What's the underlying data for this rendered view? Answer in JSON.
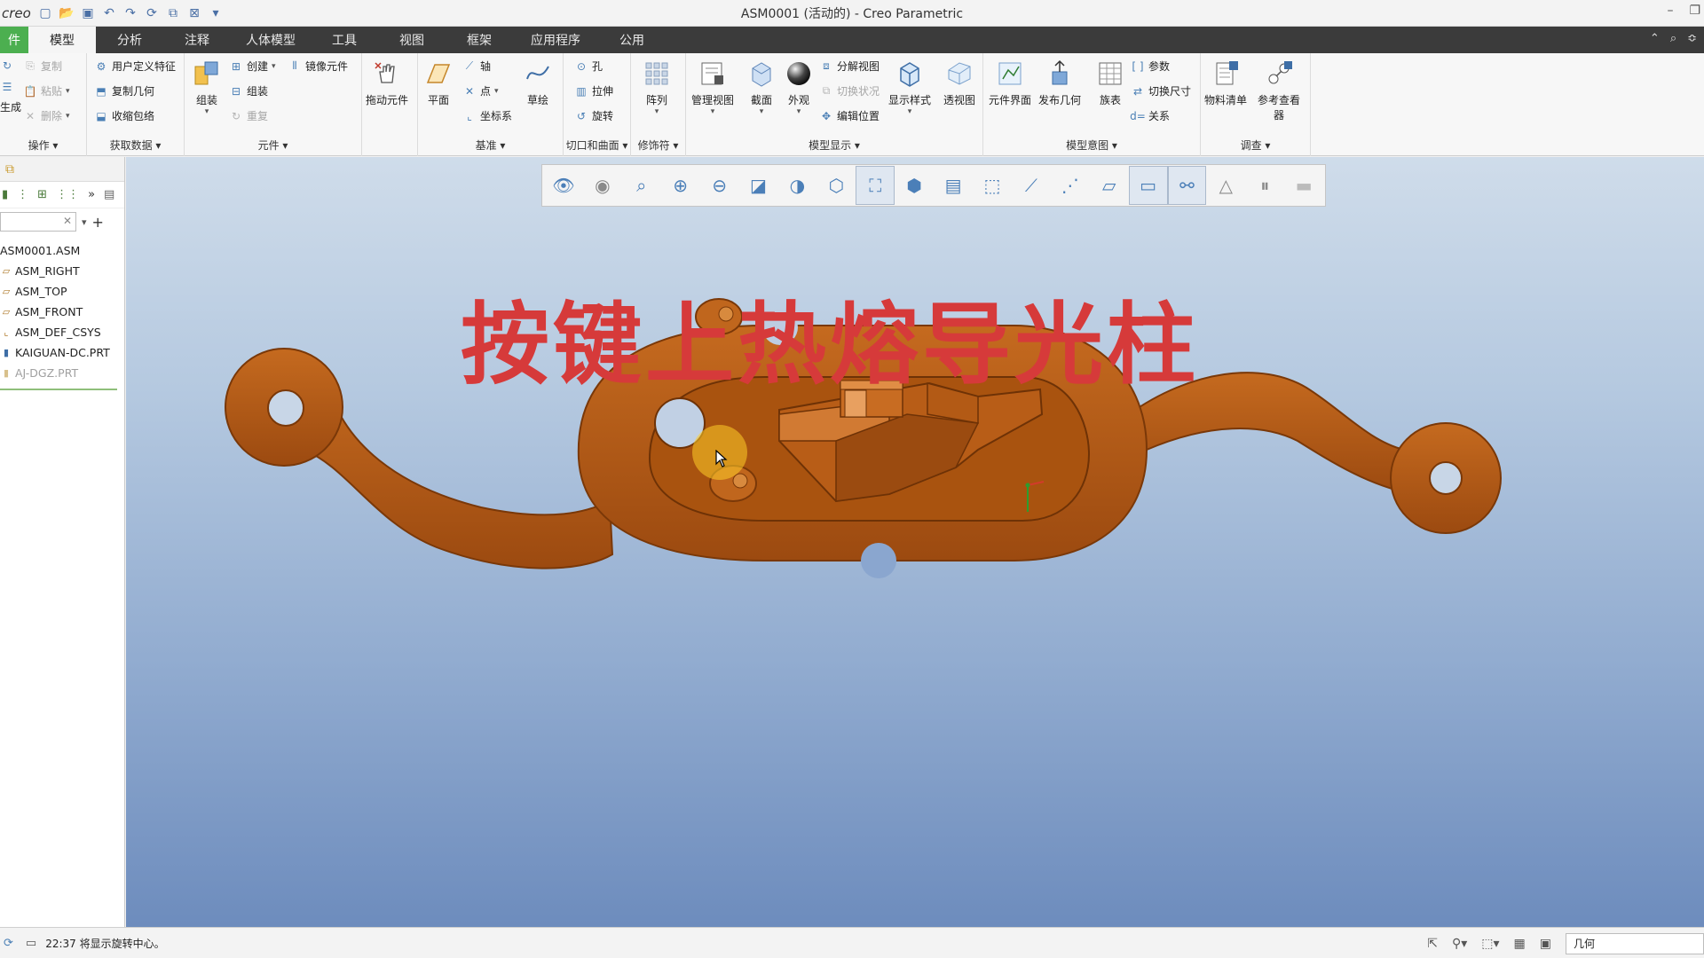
{
  "window": {
    "brand": "creo°",
    "title": "ASM0001 (活动的) - Creo Parametric"
  },
  "tabs": [
    "件",
    "模型",
    "分析",
    "注释",
    "人体模型",
    "工具",
    "视图",
    "框架",
    "应用程序",
    "公用"
  ],
  "ribbon": {
    "operations": {
      "label": "操作",
      "items": [
        "复制",
        "粘贴",
        "删除"
      ],
      "regen": "生成"
    },
    "get_data": {
      "label": "获取数据",
      "items": [
        "用户定义特征",
        "复制几何",
        "收缩包络"
      ]
    },
    "components": {
      "label": "元件",
      "assemble": "组装",
      "items": [
        "创建",
        "组装",
        "重复"
      ],
      "mirror": "镜像元件",
      "drag": "拖动元件"
    },
    "datum": {
      "label": "基准",
      "plane": "平面",
      "items": [
        "轴",
        "点",
        "坐标系"
      ],
      "sketch": "草绘"
    },
    "cuts": {
      "label": "切口和曲面",
      "items": [
        "孔",
        "拉伸",
        "旋转"
      ]
    },
    "modifiers": {
      "label": "修饰符",
      "pattern": "阵列"
    },
    "model_display": {
      "label": "模型显示",
      "manage_views": "管理视图",
      "section": "截面",
      "appearance": "外观",
      "items": [
        "分解视图",
        "切换状况",
        "编辑位置"
      ],
      "display_style": "显示样式",
      "perspective": "透视图"
    },
    "model_intent": {
      "label": "模型意图",
      "component_interface": "元件界面",
      "publish_geometry": "发布几何",
      "family_table": "族表",
      "items": [
        "参数",
        "切换尺寸",
        "关系"
      ]
    },
    "investigate": {
      "label": "调查",
      "bom": "物料清单",
      "reference_viewer_1": "参考查看",
      "reference_viewer_2": "器"
    }
  },
  "model_tree": {
    "items": [
      {
        "label": "ASM0001.ASM",
        "dim": false,
        "icon": "assembly-icon"
      },
      {
        "label": "ASM_RIGHT",
        "dim": false,
        "icon": "datum-plane-icon"
      },
      {
        "label": "ASM_TOP",
        "dim": false,
        "icon": "datum-plane-icon"
      },
      {
        "label": "ASM_FRONT",
        "dim": false,
        "icon": "datum-plane-icon"
      },
      {
        "label": "ASM_DEF_CSYS",
        "dim": false,
        "icon": "csys-icon"
      },
      {
        "label": "KAIGUAN-DC.PRT",
        "dim": false,
        "icon": "part-icon"
      },
      {
        "label": "AJ-DGZ.PRT",
        "dim": true,
        "icon": "part-icon"
      }
    ]
  },
  "viewport": {
    "overlay_title": "按键上热熔导光柱",
    "colors": {
      "part": "#b0520f",
      "overlay_text": "#d63a3a"
    }
  },
  "status": {
    "message": "22:37 将显示旋转中心。",
    "filter": "几何"
  }
}
